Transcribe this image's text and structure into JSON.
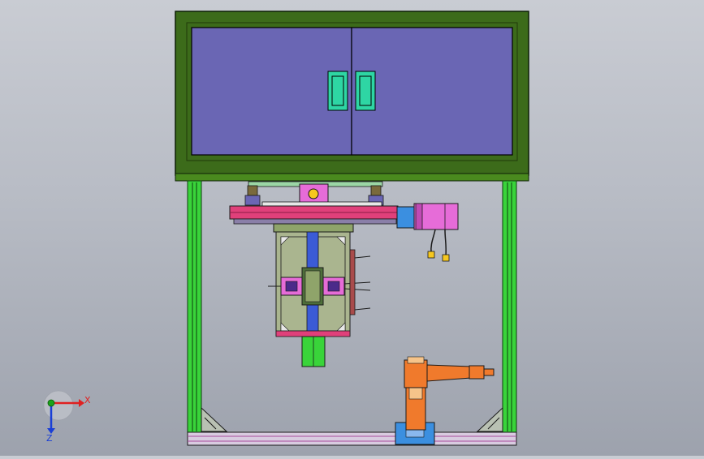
{
  "colors": {
    "background_top": "#c9ccd3",
    "background_bottom": "#9da2ad",
    "frame_green": "#3c6b1a",
    "frame_edge": "#1f3a0b",
    "post_green": "#39d43a",
    "panel_blue": "#6a66b4",
    "handle_teal": "#2ed6a4",
    "rail_pink": "#e0407a",
    "motor_magenta": "#e66cd8",
    "carriage_olive": "#8fa46a",
    "robot_orange": "#f07a2c",
    "base_blue": "#3b8fe0",
    "axis_x_red": "#e02020",
    "axis_y_green": "#1aa31a",
    "axis_z_blue": "#1a3fd6"
  },
  "triad": {
    "x_label": "X",
    "z_label": "Z"
  }
}
